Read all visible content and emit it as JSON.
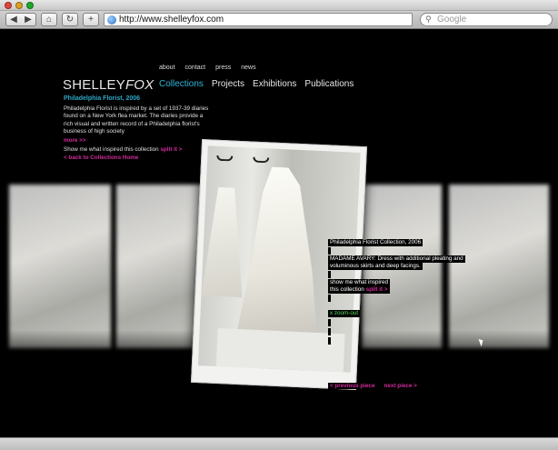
{
  "browser": {
    "back_label": "◀",
    "forward_label": "▶",
    "home_label": "⌂",
    "reload_label": "↻",
    "add_label": "+",
    "url": "http://www.shelleyfox.com",
    "search_placeholder": "Google"
  },
  "site": {
    "top_nav": [
      "about",
      "contact",
      "press",
      "news"
    ],
    "logo_main": "SHELLEY",
    "logo_italic": "FOX",
    "main_nav": [
      "Collections",
      "Projects",
      "Exhibitions",
      "Publications"
    ],
    "collection_title": "Philadelphia Florist, 2006",
    "collection_desc": "Philadelphia Florist is inspired by a set of 1937-39 diaries found on a New York flea market. The diaries provide a rich visual and written record of a Philadelphia florist's business of high society",
    "more_label": "more >>",
    "inspired_text": "Show me what inspired this collection",
    "split_label": "split it >",
    "back_label": "< back to Collections Home",
    "info": {
      "collection": "Philadelphia Florist Collection, 2006",
      "piece_line1": "MADAME AVARY: Dress with additional pleating and",
      "piece_line2": "voluminous skirts and deep facings.",
      "inspired_line1": "show me what inspired",
      "inspired_line2": "this collection",
      "split_label": "split it >",
      "zoom_out": "x zoom-out",
      "prev_label": "< previous piece",
      "next_label": "next piece >"
    }
  },
  "colors": {
    "accent_cyan": "#2fb6d6",
    "accent_magenta": "#d02b9b",
    "accent_green": "#5fdc6a"
  }
}
